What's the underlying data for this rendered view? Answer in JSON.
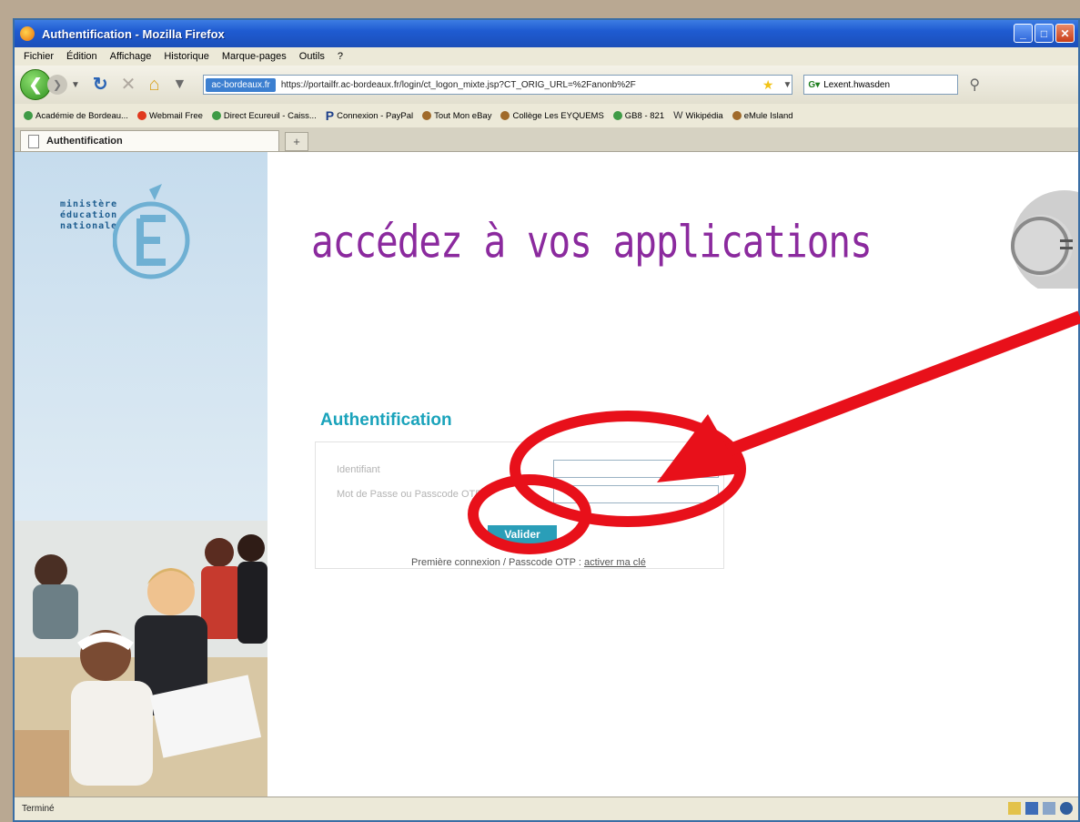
{
  "window": {
    "title": "Authentification - Mozilla Firefox",
    "buttons": {
      "minimize": "_",
      "maximize": "□",
      "close": "✕"
    }
  },
  "menu": [
    "Fichier",
    "Édition",
    "Affichage",
    "Historique",
    "Marque-pages",
    "Outils",
    "?"
  ],
  "toolbar": {
    "address_badge": "ac-bordeaux.fr",
    "url": "https://portailfr.ac-bordeaux.fr/login/ct_logon_mixte.jsp?CT_ORIG_URL=%2Fanonb%2F",
    "search_placeholder": "Lexent.hwasden",
    "newtab_label": "+"
  },
  "bookmarks": [
    {
      "label": "Académie de Bordeau...",
      "icon": "globe-icon"
    },
    {
      "label": "Webmail Free",
      "icon": "free-icon"
    },
    {
      "label": "Direct Ecureuil - Caiss...",
      "icon": "globe-icon"
    },
    {
      "label": "Connexion - PayPal",
      "icon": "paypal-icon"
    },
    {
      "label": "Tout Mon eBay",
      "icon": "ebay-icon"
    },
    {
      "label": "Collège Les EYQUEMS",
      "icon": "ebay-icon"
    },
    {
      "label": "GB8 - 821",
      "icon": "globe-icon"
    },
    {
      "label": "Wikipédia",
      "icon": "wikipedia-icon"
    },
    {
      "label": "eMule Island",
      "icon": "emule-icon"
    }
  ],
  "tab": {
    "label": "Authentification"
  },
  "page": {
    "logo_lines": [
      "ministère",
      "éducation",
      "nationale"
    ],
    "heading": "accédez à vos applications",
    "auth_title": "Authentification",
    "identifier_label": "Identifiant",
    "password_label": "Mot de Passe ou Passcode OTP",
    "validate_label": "Valider",
    "first_connection_text": "Première connexion / Passcode OTP :",
    "first_connection_link": "activer ma clé"
  },
  "status": {
    "text": "Terminé"
  },
  "colors": {
    "heading": "#8b2a9e",
    "auth_title": "#1aa3bb",
    "button": "#2a9eb8",
    "annotation": "#e8101a"
  }
}
